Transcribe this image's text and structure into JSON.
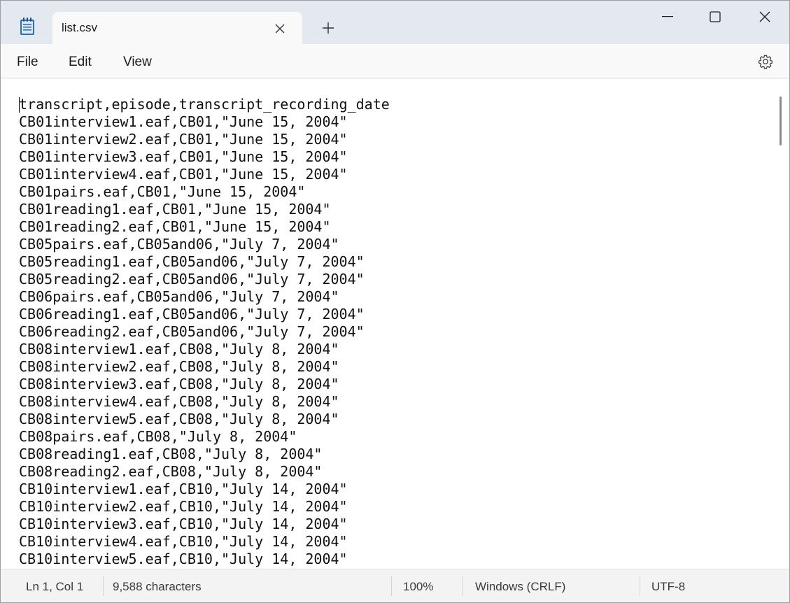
{
  "window": {
    "tab_title": "list.csv",
    "app_icon": "notepad-icon",
    "tab_close_icon": "close-icon",
    "new_tab_icon": "plus-icon",
    "controls": [
      "minimize-icon",
      "maximize-icon",
      "close-icon"
    ]
  },
  "menu": {
    "file": "File",
    "edit": "Edit",
    "view": "View",
    "settings_icon": "gear-icon"
  },
  "editor": {
    "lines": [
      "transcript,episode,transcript_recording_date",
      "CB01interview1.eaf,CB01,\"June 15, 2004\"",
      "CB01interview2.eaf,CB01,\"June 15, 2004\"",
      "CB01interview3.eaf,CB01,\"June 15, 2004\"",
      "CB01interview4.eaf,CB01,\"June 15, 2004\"",
      "CB01pairs.eaf,CB01,\"June 15, 2004\"",
      "CB01reading1.eaf,CB01,\"June 15, 2004\"",
      "CB01reading2.eaf,CB01,\"June 15, 2004\"",
      "CB05pairs.eaf,CB05and06,\"July 7, 2004\"",
      "CB05reading1.eaf,CB05and06,\"July 7, 2004\"",
      "CB05reading2.eaf,CB05and06,\"July 7, 2004\"",
      "CB06pairs.eaf,CB05and06,\"July 7, 2004\"",
      "CB06reading1.eaf,CB05and06,\"July 7, 2004\"",
      "CB06reading2.eaf,CB05and06,\"July 7, 2004\"",
      "CB08interview1.eaf,CB08,\"July 8, 2004\"",
      "CB08interview2.eaf,CB08,\"July 8, 2004\"",
      "CB08interview3.eaf,CB08,\"July 8, 2004\"",
      "CB08interview4.eaf,CB08,\"July 8, 2004\"",
      "CB08interview5.eaf,CB08,\"July 8, 2004\"",
      "CB08pairs.eaf,CB08,\"July 8, 2004\"",
      "CB08reading1.eaf,CB08,\"July 8, 2004\"",
      "CB08reading2.eaf,CB08,\"July 8, 2004\"",
      "CB10interview1.eaf,CB10,\"July 14, 2004\"",
      "CB10interview2.eaf,CB10,\"July 14, 2004\"",
      "CB10interview3.eaf,CB10,\"July 14, 2004\"",
      "CB10interview4.eaf,CB10,\"July 14, 2004\"",
      "CB10interview5.eaf,CB10,\"July 14, 2004\""
    ]
  },
  "status": {
    "position": "Ln 1, Col 1",
    "characters": "9,588 characters",
    "zoom": "100%",
    "line_ending": "Windows (CRLF)",
    "encoding": "UTF-8"
  }
}
